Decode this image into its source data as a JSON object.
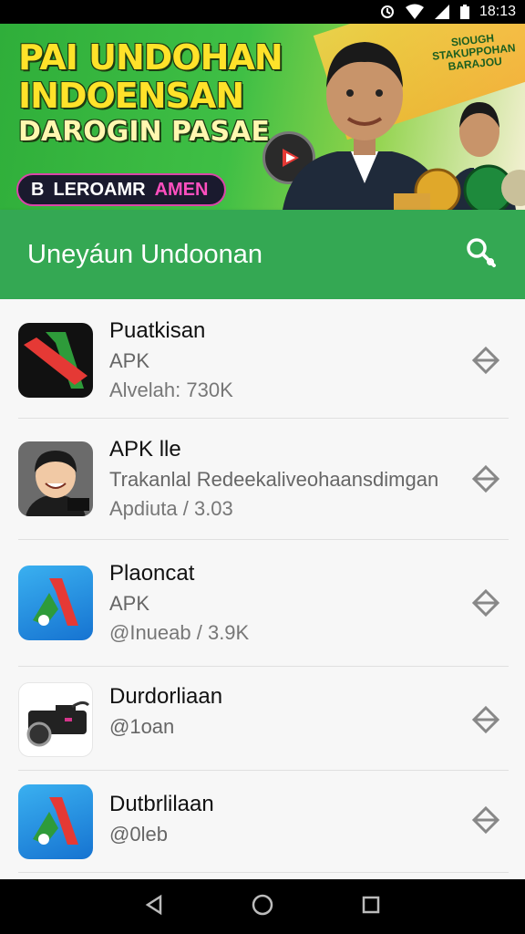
{
  "status_bar": {
    "time": "18:13"
  },
  "banner": {
    "line1": "PAI UNDOHAN",
    "line2": "INDOENSAN",
    "line3": "DAROGIN PASAE",
    "pill_text": "LEROAMR",
    "pill_accent": "AMEN",
    "pill_prefix": "B",
    "seal_text": "SIOUGH\nSTAKUPPOHAN\nBARAJOU"
  },
  "toolbar": {
    "title": "Uneyáun Undoonan",
    "search_icon": "search-icon"
  },
  "apps": [
    {
      "name": "Puatkisan",
      "line2": "APK",
      "line3": "Alvelah: 730K",
      "icon": "red-green-a-icon"
    },
    {
      "name": "APK lle",
      "line2": "Trakanlal Redeekaliveohaansdimgan",
      "line3": "Apdiuta / 3.03",
      "icon": "cartoon-avatar-icon"
    },
    {
      "name": "Plaoncat",
      "line2": "APK",
      "line3": "@Inueab / 3.9K",
      "icon": "blue-a-icon"
    },
    {
      "name": "Durdorliaan",
      "line2": "@1oan",
      "line3": "",
      "icon": "camera-car-icon"
    },
    {
      "name": "Dutbrlilaan",
      "line2": "@0leb",
      "line3": "",
      "icon": "blue-a-icon"
    }
  ],
  "colors": {
    "toolbar": "#34a853",
    "banner_text": "#ffe22a"
  }
}
